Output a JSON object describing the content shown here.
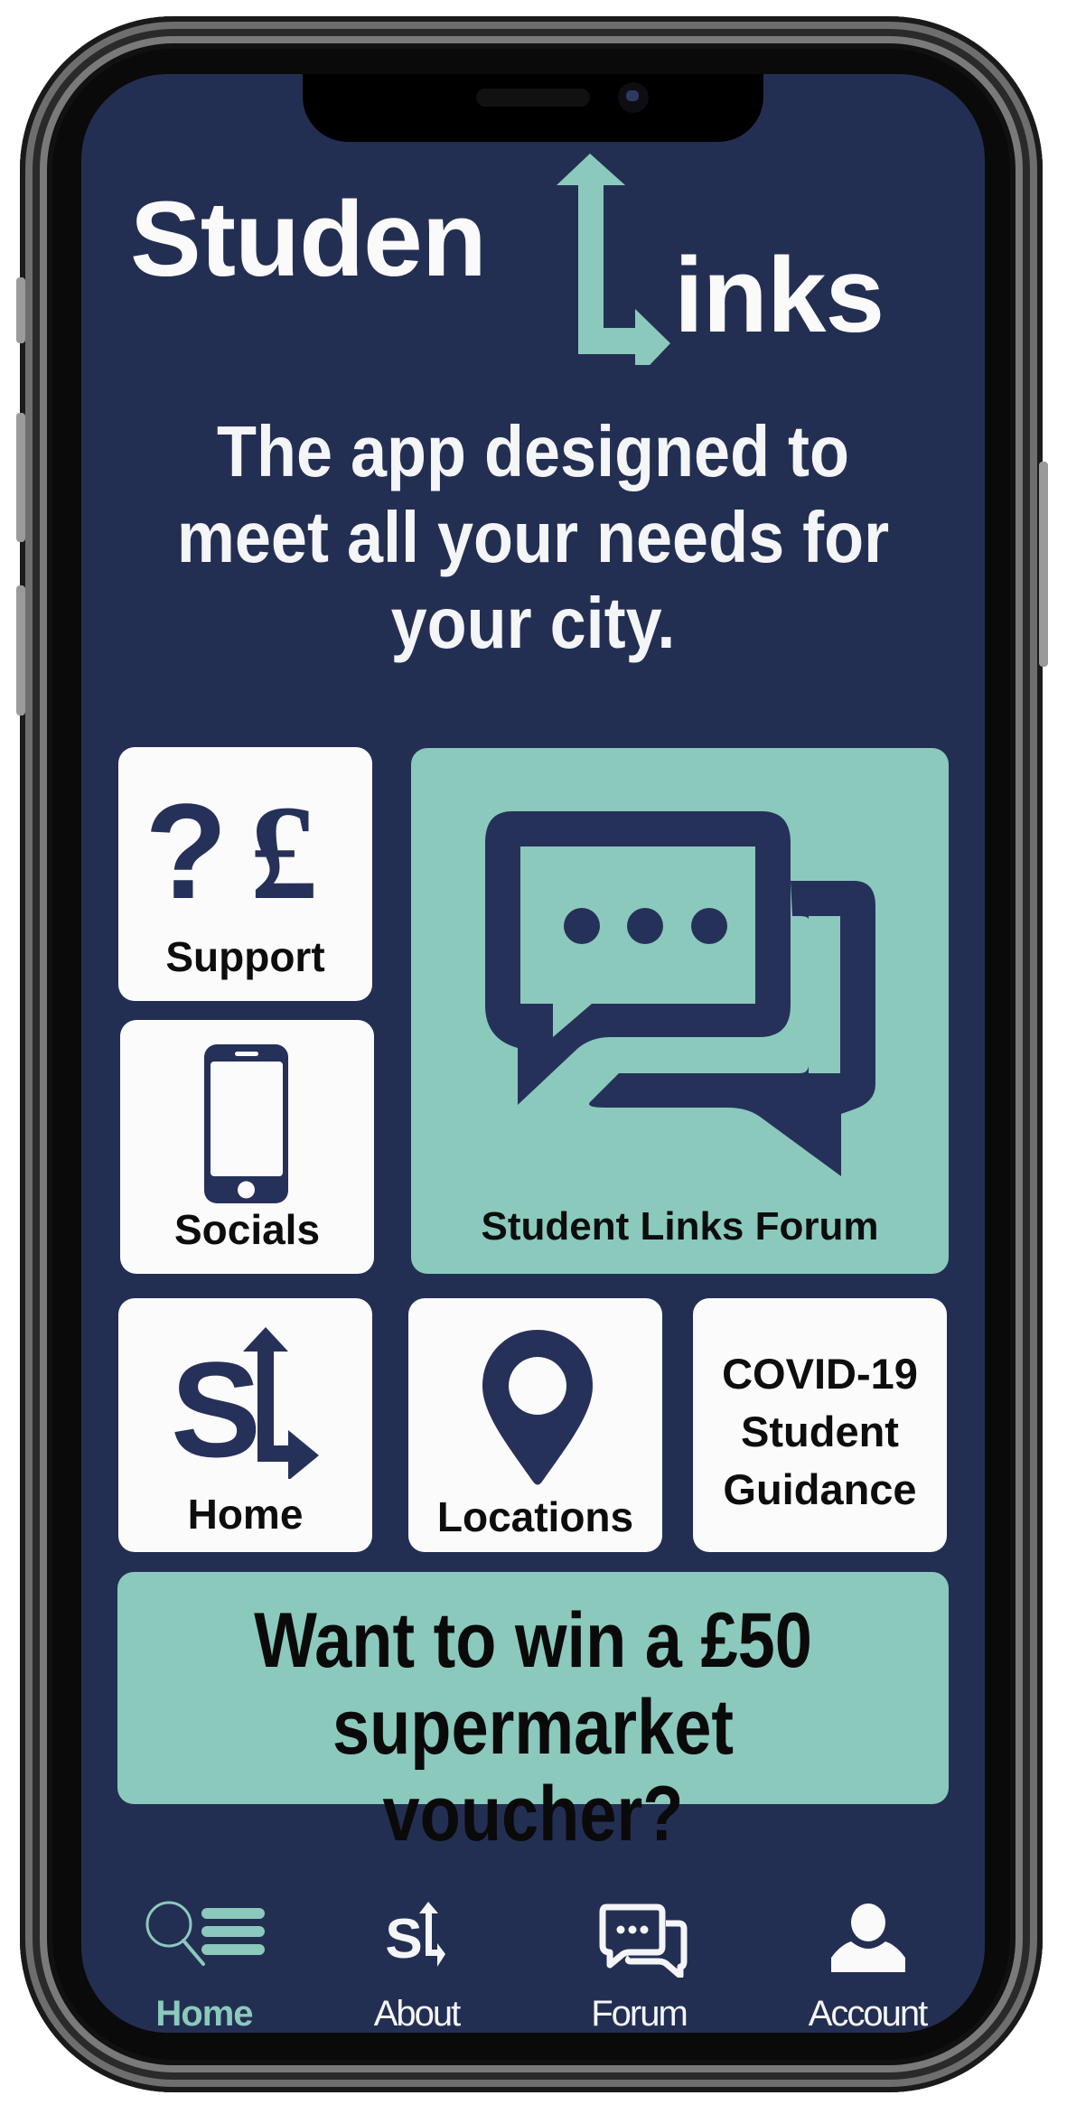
{
  "app": {
    "logo": {
      "part1": "Studen",
      "part2": "inks",
      "logo_arrow_icon": "L-arrow-icon"
    },
    "tagline": [
      "The app designed to",
      "meet all your needs for",
      "your city."
    ]
  },
  "tiles": {
    "support": {
      "label": "Support",
      "icon": "question-pound-icon",
      "glyph_q": "?",
      "glyph_pound": "£"
    },
    "socials": {
      "label": "Socials",
      "icon": "smartphone-icon"
    },
    "forum": {
      "label": "Student Links Forum",
      "icon": "chat-bubbles-icon"
    },
    "home": {
      "label": "Home",
      "icon": "sl-logo-icon",
      "glyph": "S"
    },
    "locations": {
      "label": "Locations",
      "icon": "map-pin-icon"
    },
    "covid": {
      "lines": [
        "COVID-19",
        "Student",
        "Guidance"
      ]
    }
  },
  "banner": {
    "lines": [
      "Want to win a £50",
      "supermarket voucher?"
    ]
  },
  "bottom_nav": {
    "items": [
      {
        "label": "Home",
        "icon": "search-list-icon",
        "active": true
      },
      {
        "label": "About",
        "icon": "sl-logo-icon",
        "active": false
      },
      {
        "label": "Forum",
        "icon": "chat-bubbles-icon",
        "active": false
      },
      {
        "label": "Account",
        "icon": "user-icon",
        "active": false
      }
    ]
  },
  "colors": {
    "background": "#232f52",
    "accent": "#8bc9bd",
    "tile": "#fbfbfc",
    "icon": "#26315a",
    "text_dark": "#0d0d0d"
  }
}
